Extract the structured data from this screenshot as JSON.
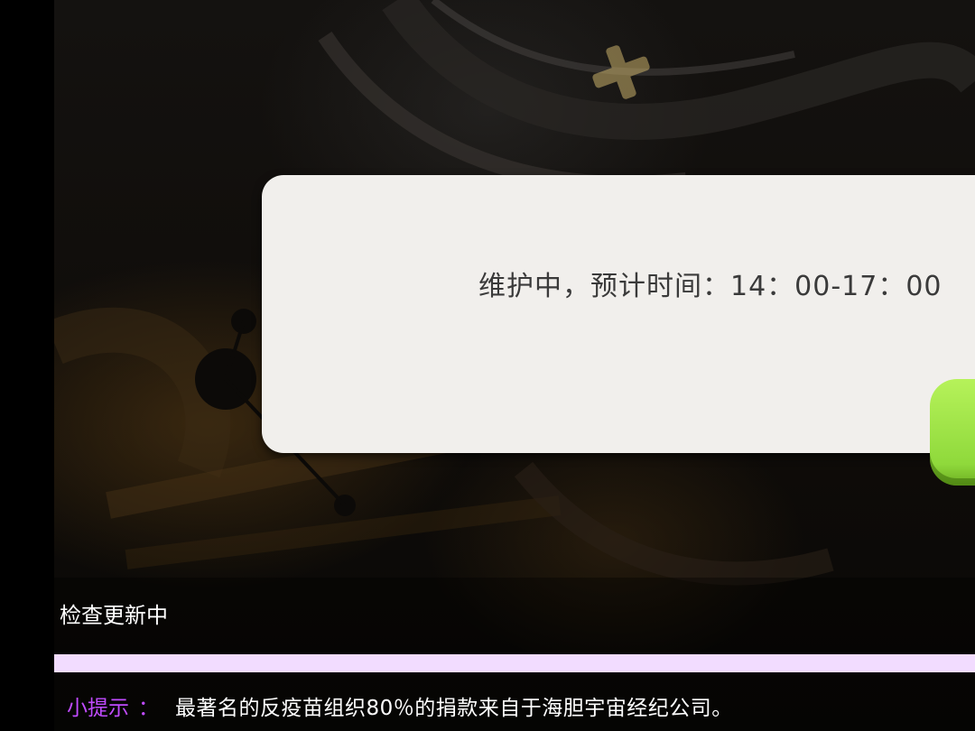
{
  "dialog": {
    "message": "维护中，预计时间：14：00-17：00"
  },
  "loading": {
    "status": "检查更新中",
    "progress_percent": 100
  },
  "tip": {
    "label": "小提示",
    "separator": "：",
    "text": "最著名的反疫苗组织80％的捐款来自于海胆宇宙经纪公司。"
  },
  "colors": {
    "dialog_bg": "#f1efec",
    "button_green": "#a6e64a",
    "progress_fill": "#f2dcff",
    "tip_label": "#c04bff"
  }
}
